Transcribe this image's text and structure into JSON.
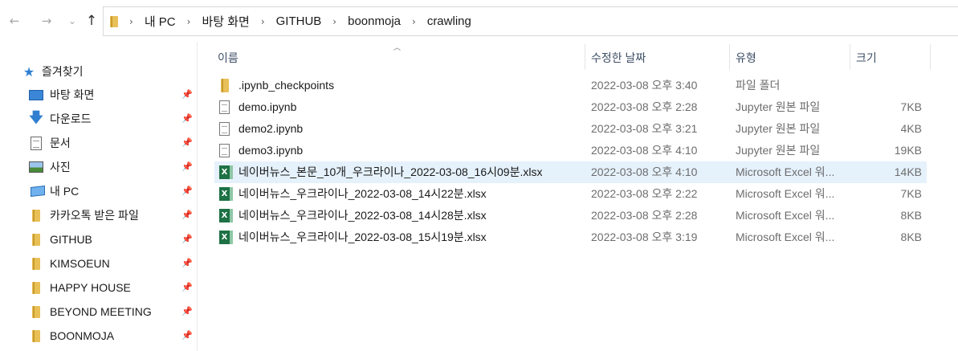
{
  "nav": {
    "back": "←",
    "forward": "→",
    "recent": "⌄",
    "up": "↑"
  },
  "breadcrumb": [
    "내 PC",
    "바탕 화면",
    "GITHUB",
    "boonmoja",
    "crawling"
  ],
  "breadcrumb_sep": "›",
  "sidebar": {
    "quick_access": "즐겨찾기",
    "items": [
      {
        "label": "바탕 화면",
        "icon": "desktop-icon"
      },
      {
        "label": "다운로드",
        "icon": "download-icon"
      },
      {
        "label": "문서",
        "icon": "document-icon"
      },
      {
        "label": "사진",
        "icon": "pictures-icon"
      },
      {
        "label": "내 PC",
        "icon": "pc-icon"
      },
      {
        "label": "카카오톡 받은 파일",
        "icon": "folder-icon"
      },
      {
        "label": "GITHUB",
        "icon": "folder-icon"
      },
      {
        "label": "KIMSOEUN",
        "icon": "folder-icon"
      },
      {
        "label": "HAPPY HOUSE",
        "icon": "folder-icon"
      },
      {
        "label": "BEYOND MEETING",
        "icon": "folder-icon"
      },
      {
        "label": "BOONMOJA",
        "icon": "folder-icon"
      }
    ]
  },
  "columns": {
    "name": "이름",
    "date": "수정한 날짜",
    "type": "유형",
    "size": "크기"
  },
  "files": [
    {
      "name": ".ipynb_checkpoints",
      "date": "2022-03-08 오후 3:40",
      "type": "파일 폴더",
      "size": "",
      "icon": "folder-icon"
    },
    {
      "name": "demo.ipynb",
      "date": "2022-03-08 오후 2:28",
      "type": "Jupyter 원본 파일",
      "size": "7KB",
      "icon": "file-icon"
    },
    {
      "name": "demo2.ipynb",
      "date": "2022-03-08 오후 3:21",
      "type": "Jupyter 원본 파일",
      "size": "4KB",
      "icon": "file-icon"
    },
    {
      "name": "demo3.ipynb",
      "date": "2022-03-08 오후 4:10",
      "type": "Jupyter 원본 파일",
      "size": "19KB",
      "icon": "file-icon"
    },
    {
      "name": "네이버뉴스_본문_10개_우크라이나_2022-03-08_16시09분.xlsx",
      "date": "2022-03-08 오후 4:10",
      "type": "Microsoft Excel 워...",
      "size": "14KB",
      "icon": "excel-icon",
      "selected": true
    },
    {
      "name": "네이버뉴스_우크라이나_2022-03-08_14시22분.xlsx",
      "date": "2022-03-08 오후 2:22",
      "type": "Microsoft Excel 워...",
      "size": "7KB",
      "icon": "excel-icon"
    },
    {
      "name": "네이버뉴스_우크라이나_2022-03-08_14시28분.xlsx",
      "date": "2022-03-08 오후 2:28",
      "type": "Microsoft Excel 워...",
      "size": "8KB",
      "icon": "excel-icon"
    },
    {
      "name": "네이버뉴스_우크라이나_2022-03-08_15시19분.xlsx",
      "date": "2022-03-08 오후 3:19",
      "type": "Microsoft Excel 워...",
      "size": "8KB",
      "icon": "excel-icon"
    }
  ]
}
